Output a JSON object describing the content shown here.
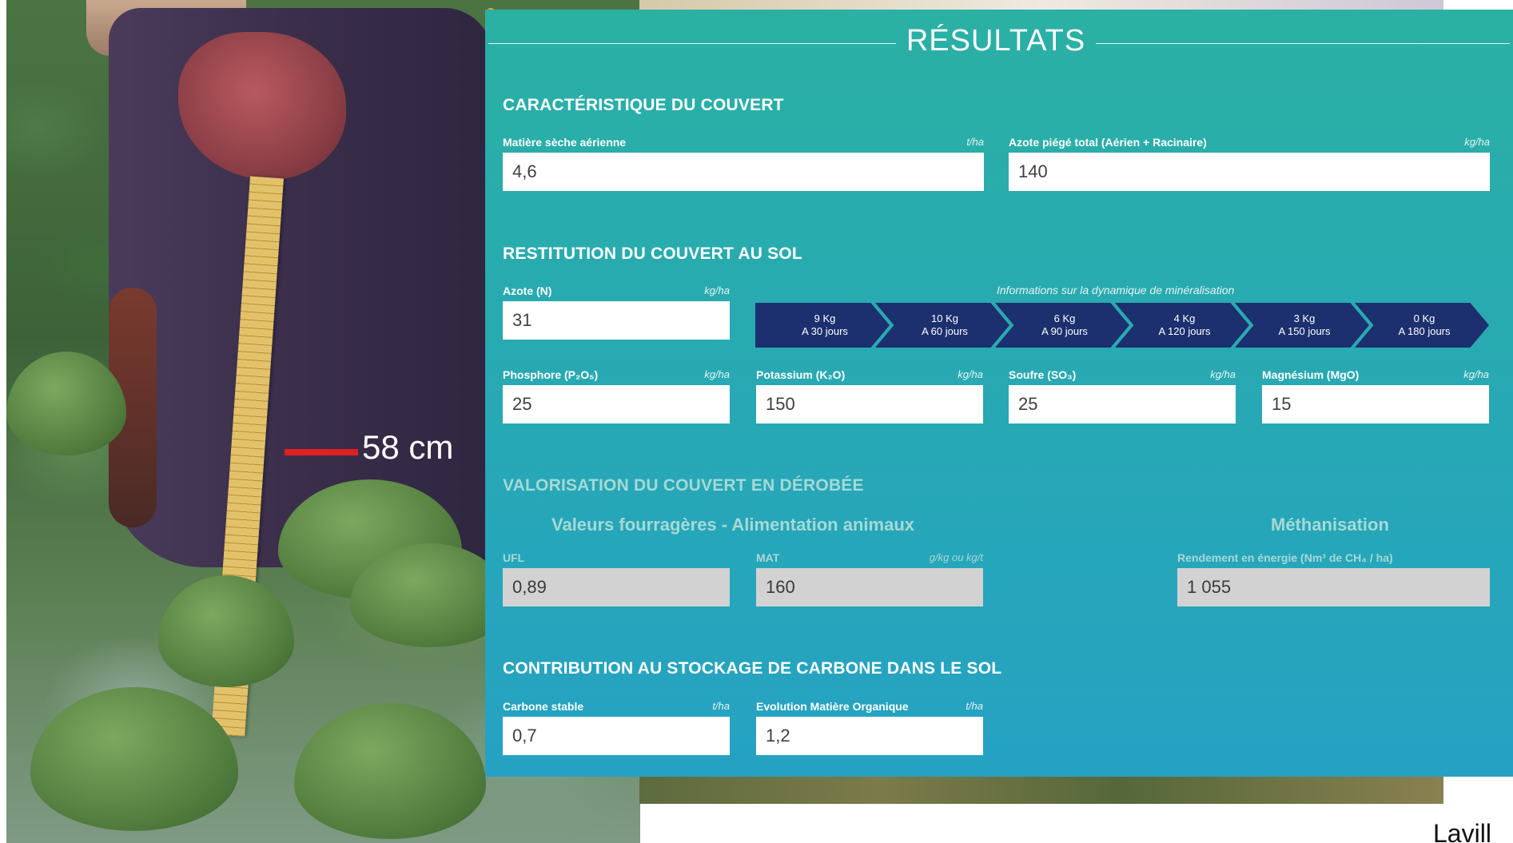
{
  "annotation": {
    "measure_label": "58 cm",
    "credit_fragment": "Lavill",
    "colors": {
      "measure_line": "#e0201f"
    }
  },
  "panel": {
    "title": "RÉSULTATS",
    "colors": {
      "panel_top": "#2bb0a4",
      "panel_bottom": "#25a2c3",
      "chevron": "#1c2f6e",
      "grey_field": "#d2d2d2"
    },
    "caracteristique": {
      "heading": "CARACTÉRISTIQUE DU COUVERT",
      "matiere_seche": {
        "label": "Matière sèche aérienne",
        "unit": "t/ha",
        "value": "4,6"
      },
      "azote_piege": {
        "label": "Azote piégé total (Aérien + Racinaire)",
        "unit": "kg/ha",
        "value": "140"
      }
    },
    "restitution": {
      "heading": "RESTITUTION DU COUVERT AU SOL",
      "azote": {
        "label": "Azote (N)",
        "unit": "kg/ha",
        "value": "31"
      },
      "mineralisation_caption": "Informations sur la dynamique de minéralisation",
      "mineralisation_steps": [
        {
          "kg": "9 Kg",
          "jours": "A 30 jours"
        },
        {
          "kg": "10 Kg",
          "jours": "A 60 jours"
        },
        {
          "kg": "6 Kg",
          "jours": "A 90 jours"
        },
        {
          "kg": "4 Kg",
          "jours": "A 120 jours"
        },
        {
          "kg": "3 Kg",
          "jours": "A 150 jours"
        },
        {
          "kg": "0 Kg",
          "jours": "A 180 jours"
        }
      ],
      "phosphore": {
        "label": "Phosphore (P₂O₅)",
        "unit": "kg/ha",
        "value": "25"
      },
      "potassium": {
        "label": "Potassium (K₂O)",
        "unit": "kg/ha",
        "value": "150"
      },
      "soufre": {
        "label": "Soufre (SO₃)",
        "unit": "kg/ha",
        "value": "25"
      },
      "magnesium": {
        "label": "Magnésium (MgO)",
        "unit": "kg/ha",
        "value": "15"
      }
    },
    "valorisation": {
      "heading": "VALORISATION DU COUVERT EN DÉROBÉE",
      "fourrage_heading": "Valeurs fourragères - Alimentation animaux",
      "methanisation_heading": "Méthanisation",
      "ufl": {
        "label": "UFL",
        "unit": "",
        "value": "0,89"
      },
      "mat": {
        "label": "MAT",
        "unit": "g/kg ou kg/t",
        "value": "160"
      },
      "rendement": {
        "label": "Rendement en énergie (Nm³ de CH₄ / ha)",
        "unit": "",
        "value": "1 055"
      }
    },
    "carbone": {
      "heading": "CONTRIBUTION AU STOCKAGE DE CARBONE DANS LE SOL",
      "carbone_stable": {
        "label": "Carbone stable",
        "unit": "t/ha",
        "value": "0,7"
      },
      "evolution_mo": {
        "label": "Evolution Matière Organique",
        "unit": "t/ha",
        "value": "1,2"
      }
    }
  }
}
